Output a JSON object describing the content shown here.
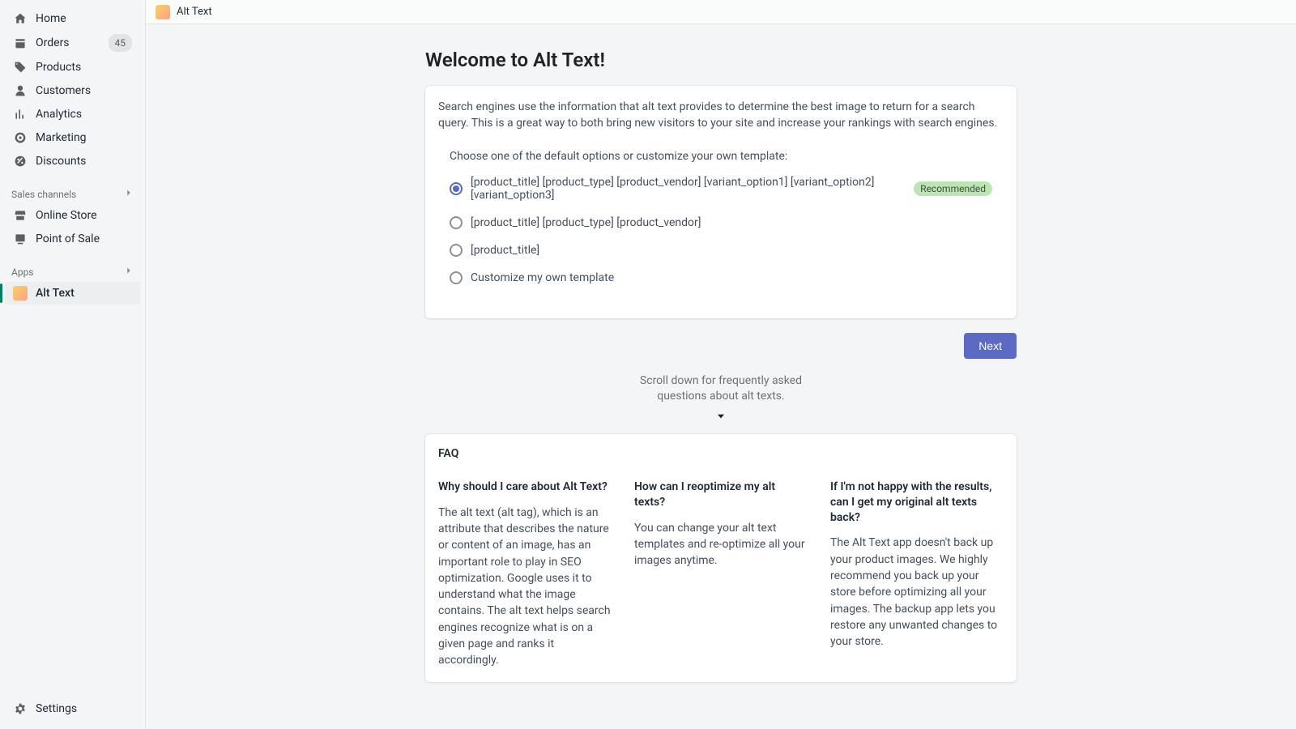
{
  "sidebar": {
    "items": [
      {
        "label": "Home"
      },
      {
        "label": "Orders",
        "badge": "45"
      },
      {
        "label": "Products"
      },
      {
        "label": "Customers"
      },
      {
        "label": "Analytics"
      },
      {
        "label": "Marketing"
      },
      {
        "label": "Discounts"
      }
    ],
    "sales_channels_header": "Sales channels",
    "sales_channels": [
      {
        "label": "Online Store"
      },
      {
        "label": "Point of Sale"
      }
    ],
    "apps_header": "Apps",
    "apps": [
      {
        "label": "Alt Text"
      }
    ],
    "settings_label": "Settings"
  },
  "topbar": {
    "title": "Alt Text"
  },
  "page": {
    "title": "Welcome to Alt Text!",
    "intro": "Search engines use the information that alt text provides to determine the best image to return for a search query. This is a great way to both bring new visitors to your site and increase your rankings with search engines.",
    "options_prompt": "Choose one of the default options or customize your own template:",
    "options": [
      {
        "label": "[product_title] [product_type] [product_vendor] [variant_option1] [variant_option2] [variant_option3]",
        "recommended": true,
        "selected": true
      },
      {
        "label": "[product_title] [product_type] [product_vendor]"
      },
      {
        "label": "[product_title]"
      },
      {
        "label": "Customize my own template"
      }
    ],
    "recommended_badge": "Recommended",
    "next_button": "Next",
    "scroll_hint": "Scroll down for frequently asked questions about alt texts."
  },
  "faq": {
    "heading": "FAQ",
    "items": [
      {
        "q": "Why should I care about Alt Text?",
        "a": "The alt text (alt tag), which is an attribute that describes the nature or content of an image, has an important role to play in SEO optimization. Google uses it to understand what the image contains. The alt text helps search engines recognize what is on a given page and ranks it accordingly."
      },
      {
        "q": "How can I reoptimize my alt texts?",
        "a": "You can change your alt text templates and re-optimize all your images anytime."
      },
      {
        "q": "If I'm not happy with the results, can I get my original alt texts back?",
        "a": "The Alt Text app doesn't back up your product images. We highly recommend you back up your store before optimizing all your images. The backup app lets you restore any unwanted changes to your store."
      }
    ]
  }
}
